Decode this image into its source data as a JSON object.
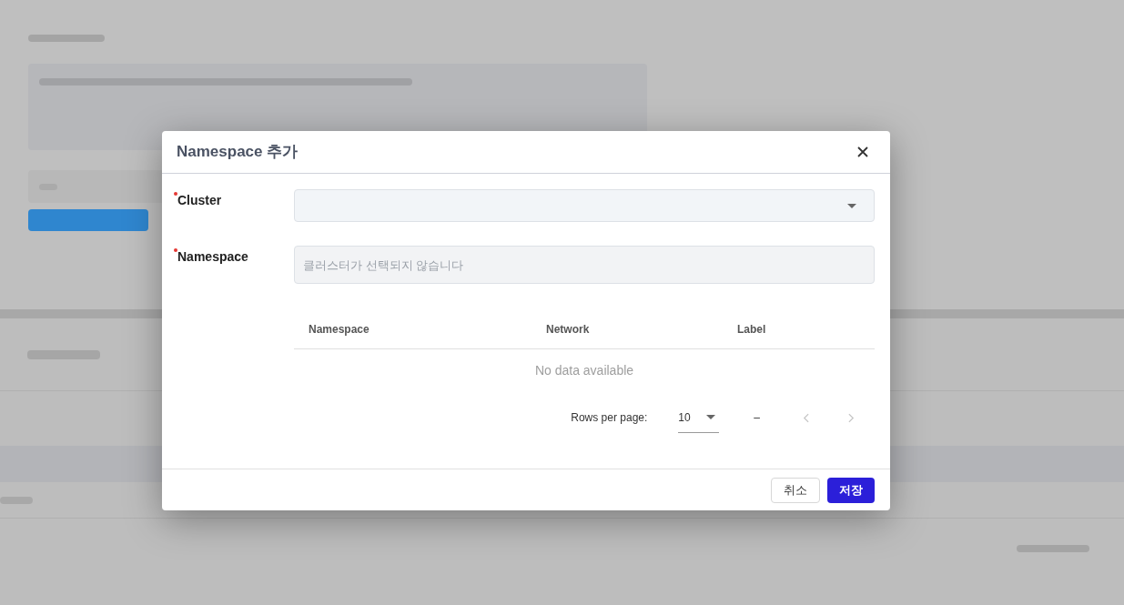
{
  "dialog": {
    "title": "Namespace 추가",
    "fields": [
      {
        "kind": "select",
        "label": "Cluster",
        "required": true
      },
      {
        "kind": "input",
        "label": "Namespace",
        "required": true,
        "placeholder": "클러스터가 선택되지 않습니다"
      }
    ],
    "table": {
      "columns": [
        "Namespace",
        "Network",
        "Label"
      ],
      "empty_text": "No data available"
    },
    "pagination": {
      "rows_per_page_label": "Rows per page:",
      "rows_per_page": "10",
      "range": "–",
      "prev_disabled": true,
      "next_disabled": true
    },
    "buttons": [
      {
        "kind": "secondary",
        "label": "취소"
      },
      {
        "kind": "primary",
        "label": "저장"
      }
    ]
  }
}
